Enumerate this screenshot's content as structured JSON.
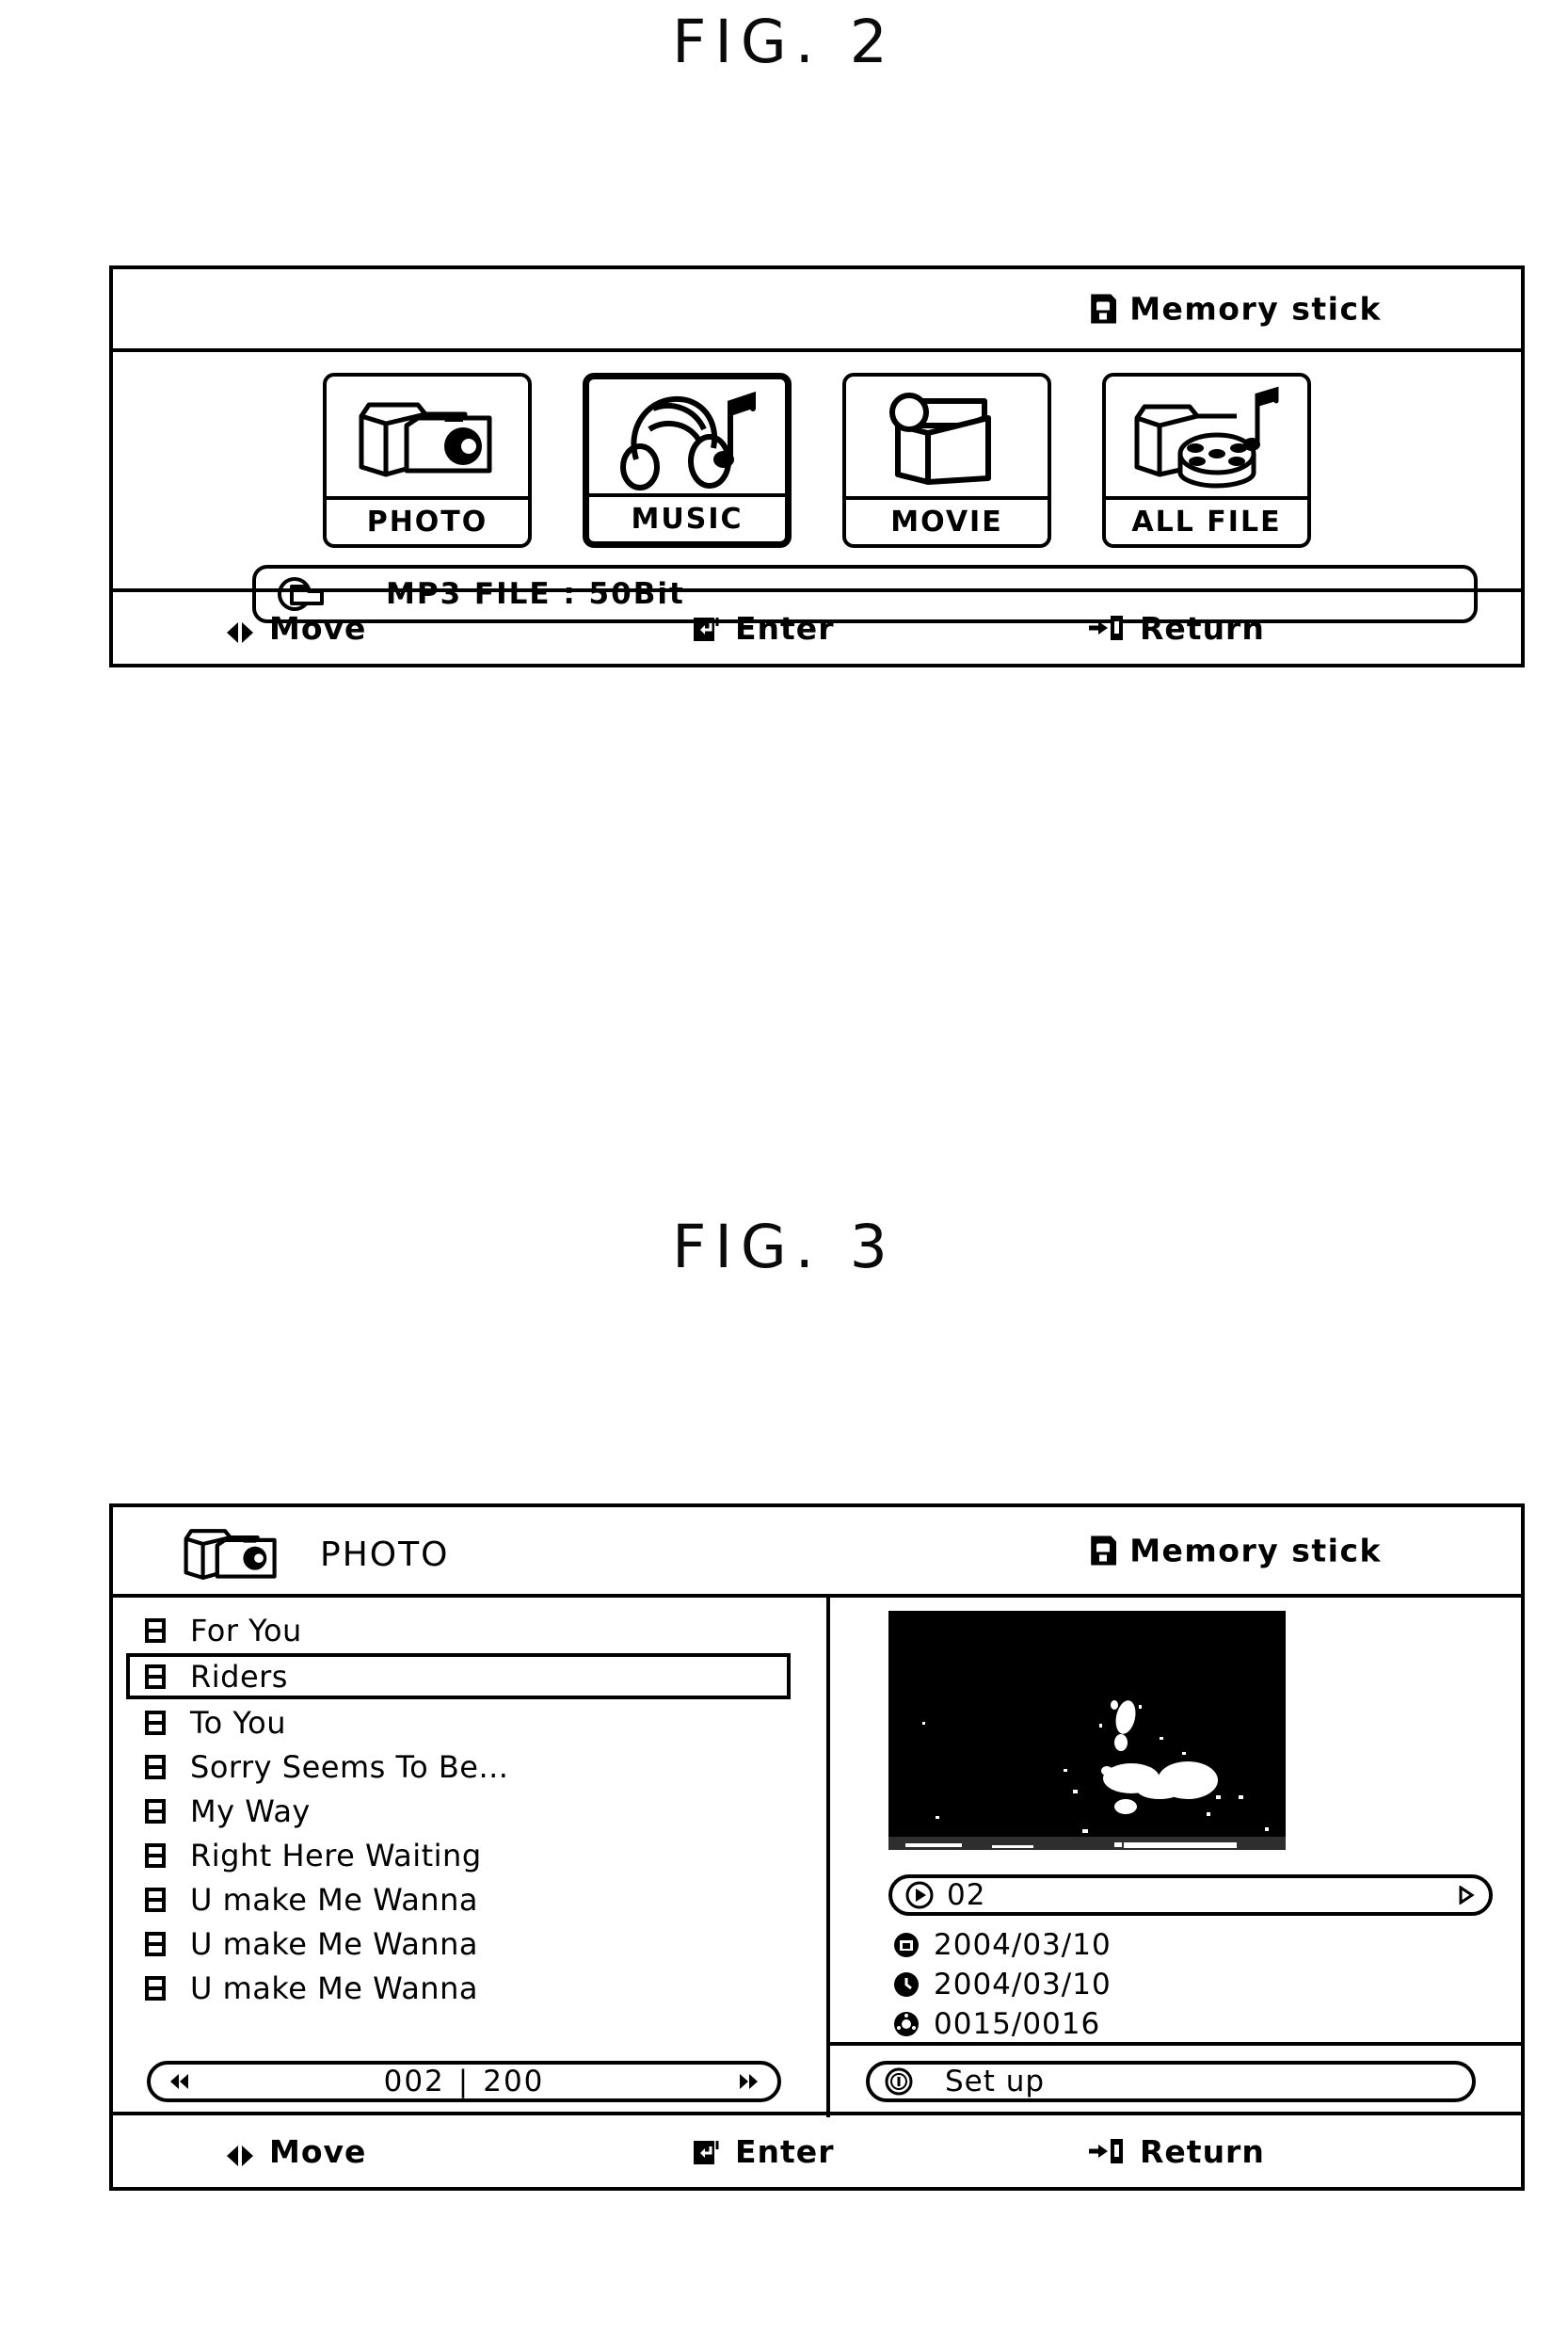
{
  "figures": {
    "fig2_title": "FIG. 2",
    "fig3_title": "FIG. 3"
  },
  "fig2": {
    "device_label": "Memory stick",
    "device_icon": "memory-stick-icon",
    "tiles": [
      {
        "label": "PHOTO",
        "icon": "folder-camera-icon",
        "selected": false
      },
      {
        "label": "MUSIC",
        "icon": "headphones-note-icon",
        "selected": true
      },
      {
        "label": "MOVIE",
        "icon": "camcorder-icon",
        "selected": false
      },
      {
        "label": "ALL FILE",
        "icon": "folder-reel-note-icon",
        "selected": false
      }
    ],
    "info_bar": {
      "icon": "folder-hand-icon",
      "text": "MP3 FILE : 50Bit"
    },
    "footer": {
      "move": "Move",
      "enter": "Enter",
      "return": "Return",
      "move_icon": "left-right-arrow-icon",
      "enter_icon": "enter-key-icon",
      "return_icon": "return-key-icon"
    }
  },
  "fig3": {
    "header": {
      "icon": "folder-camera-icon",
      "title": "PHOTO",
      "device_label": "Memory stick",
      "device_icon": "memory-stick-icon"
    },
    "files": [
      {
        "name": "For You",
        "icon": "film-file-icon",
        "selected": false
      },
      {
        "name": "Riders",
        "icon": "film-file-icon",
        "selected": true
      },
      {
        "name": "To You",
        "icon": "film-file-icon",
        "selected": false
      },
      {
        "name": "Sorry Seems To Be...",
        "icon": "film-file-icon",
        "selected": false
      },
      {
        "name": "My Way",
        "icon": "film-file-icon",
        "selected": false
      },
      {
        "name": "Right Here Waiting",
        "icon": "film-file-icon",
        "selected": false
      },
      {
        "name": "U make Me Wanna",
        "icon": "film-file-icon",
        "selected": false
      },
      {
        "name": "U make Me Wanna",
        "icon": "film-file-icon",
        "selected": false
      },
      {
        "name": "U make Me Wanna",
        "icon": "film-file-icon",
        "selected": false
      }
    ],
    "pager": {
      "current": "002",
      "separator": "|",
      "total": "200",
      "prev_icon": "double-left-arrow-icon",
      "next_icon": "double-right-arrow-icon"
    },
    "preview": {
      "thumbnail_alt": "photo-thumbnail"
    },
    "metadata": [
      {
        "icon": "play-circle-icon",
        "value": "02",
        "pill": true,
        "arrow_icon": "triangle-right-icon"
      },
      {
        "icon": "camera-circle-icon",
        "value": "2004/03/10",
        "pill": false
      },
      {
        "icon": "clock-circle-icon",
        "value": "2004/03/10",
        "pill": false
      },
      {
        "icon": "disc-circle-icon",
        "value": "0015/0016",
        "pill": false
      }
    ],
    "setup": {
      "icon": "info-circle-icon",
      "label": "Set up"
    },
    "footer": {
      "move": "Move",
      "enter": "Enter",
      "return": "Return",
      "move_icon": "left-right-arrow-icon",
      "enter_icon": "enter-key-icon",
      "return_icon": "return-key-icon"
    }
  },
  "colors": {
    "ink": "#000000",
    "paper": "#ffffff"
  }
}
